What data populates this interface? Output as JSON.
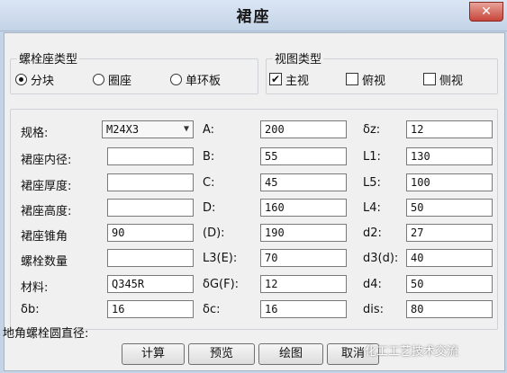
{
  "window": {
    "title": "裙座",
    "close_label": "✕"
  },
  "bolt_seat_type": {
    "title": "螺栓座类型",
    "options": [
      {
        "label": "分块",
        "selected": true
      },
      {
        "label": "圈座",
        "selected": false
      },
      {
        "label": "单环板",
        "selected": false
      }
    ]
  },
  "view_type": {
    "title": "视图类型",
    "options": [
      {
        "label": "主视",
        "checked": true,
        "mark": "✔"
      },
      {
        "label": "俯视",
        "checked": false,
        "mark": ""
      },
      {
        "label": "侧视",
        "checked": false,
        "mark": ""
      }
    ]
  },
  "params": {
    "col1": [
      {
        "label": "规格:",
        "value": "M24X3"
      },
      {
        "label": "裙座内径:",
        "value": ""
      },
      {
        "label": "裙座厚度:",
        "value": ""
      },
      {
        "label": "裙座高度:",
        "value": ""
      },
      {
        "label": "裙座锥角",
        "value": "90"
      },
      {
        "label": "螺栓数量",
        "value": ""
      },
      {
        "label": "材料:",
        "value": "Q345R"
      },
      {
        "label": "δb:",
        "value": "16"
      }
    ],
    "col2": [
      {
        "label": "A:",
        "value": "200"
      },
      {
        "label": "B:",
        "value": "55"
      },
      {
        "label": "C:",
        "value": "45"
      },
      {
        "label": "D:",
        "value": "160"
      },
      {
        "label": "(D):",
        "value": "190"
      },
      {
        "label": "L3(E):",
        "value": "70"
      },
      {
        "label": "δG(F):",
        "value": "12"
      },
      {
        "label": "δc:",
        "value": "16"
      }
    ],
    "col3": [
      {
        "label": "δz:",
        "value": "12"
      },
      {
        "label": "L1:",
        "value": "130"
      },
      {
        "label": "L5:",
        "value": "100"
      },
      {
        "label": "L4:",
        "value": "50"
      },
      {
        "label": "d2:",
        "value": "27"
      },
      {
        "label": "d3(d):",
        "value": "40"
      },
      {
        "label": "d4:",
        "value": "50"
      },
      {
        "label": "dis:",
        "value": "80"
      }
    ]
  },
  "anchor_circle_label": "地角螺栓圆直径:",
  "buttons": {
    "calc": "计算",
    "preview": "预览",
    "draw": "绘图",
    "cancel": "取消"
  },
  "icons": {
    "close": "close-icon",
    "dropdown": "chevron-down-icon"
  },
  "watermark_text": "化工工艺技术交流"
}
